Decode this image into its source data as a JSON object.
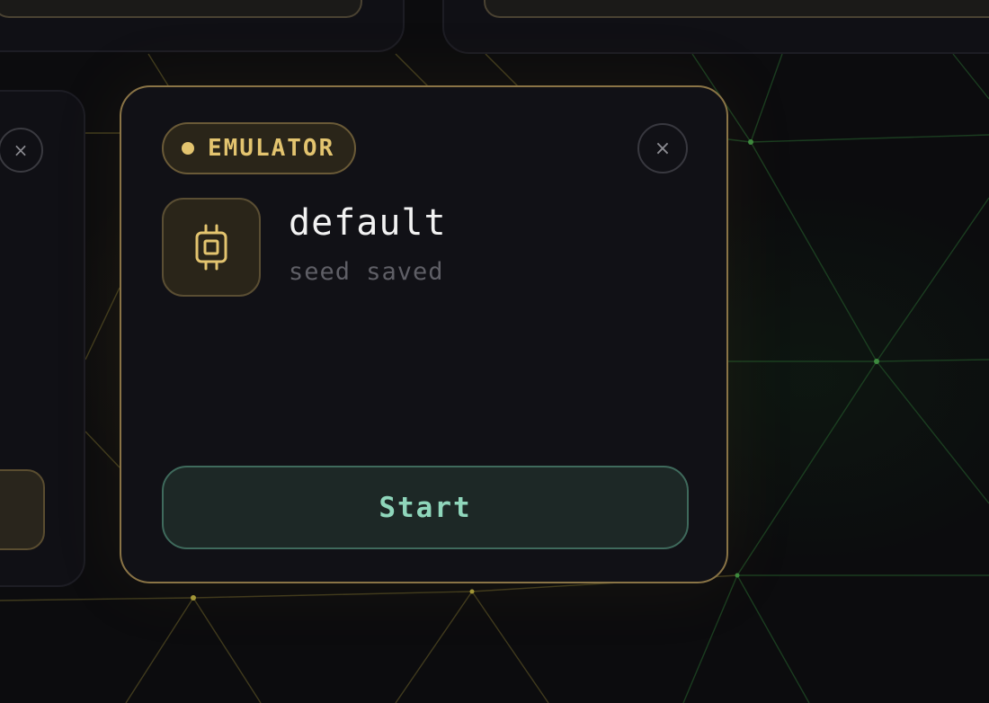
{
  "window": {
    "main_card": {
      "badge_label": "EMULATOR",
      "badge_color": "#e3c46f",
      "close_label": "×",
      "device_icon": "chip-icon",
      "device_name": "default",
      "device_status": "seed saved",
      "start_label": "Start",
      "accent_color": "#8a7446",
      "start_color": "#8fd6bb"
    },
    "left_card": {
      "close_label": "×"
    }
  }
}
